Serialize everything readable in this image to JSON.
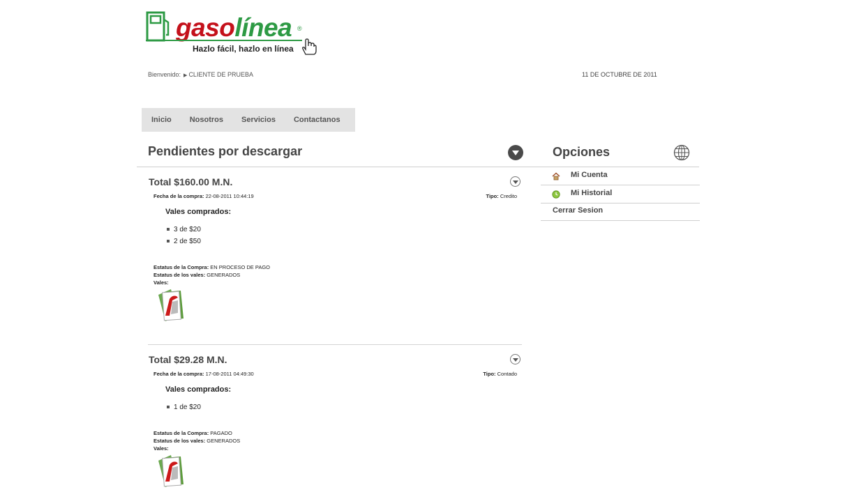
{
  "brand": {
    "word_red": "gaso",
    "word_green": "línea",
    "registered": "®",
    "tagline": "Hazlo fácil, hazlo en línea",
    "colors": {
      "red": "#c4111b",
      "green": "#2d9a44"
    }
  },
  "welcome": {
    "label": "Bienvenido:",
    "user": "CLIENTE DE PRUEBA"
  },
  "date": "11 DE OCTUBRE DE 2011",
  "nav": {
    "items": [
      {
        "label": "Inicio"
      },
      {
        "label": "Nosotros"
      },
      {
        "label": "Servicios"
      },
      {
        "label": "Contactanos"
      }
    ]
  },
  "pending": {
    "title": "Pendientes por descargar",
    "orders": [
      {
        "total": "Total $160.00 M.N.",
        "fecha_label": "Fecha de la compra:",
        "fecha": "22-08-2011 10:44:19",
        "tipo_label": "Tipo:",
        "tipo": "Credito",
        "vales_title": "Vales comprados:",
        "vales": [
          "3 de $20",
          "2 de $50"
        ],
        "estatus_compra_label": "Estatus de la Compra:",
        "estatus_compra": "EN PROCESO DE PAGO",
        "estatus_vales_label": "Estatus de los vales:",
        "estatus_vales": "GENERADOS",
        "vales_label": "Vales:"
      },
      {
        "total": "Total $29.28 M.N.",
        "fecha_label": "Fecha de la compra:",
        "fecha": "17-08-2011 04:49:30",
        "tipo_label": "Tipo:",
        "tipo": "Contado",
        "vales_title": "Vales comprados:",
        "vales": [
          "1 de $20"
        ],
        "estatus_compra_label": "Estatus de la Compra:",
        "estatus_compra": "PAGADO",
        "estatus_vales_label": "Estatus de los vales:",
        "estatus_vales": "GENERADOS",
        "vales_label": "Vales:"
      }
    ]
  },
  "options": {
    "title": "Opciones",
    "items": [
      {
        "label": "Mi Cuenta",
        "icon": "home-icon"
      },
      {
        "label": "Mi Historial",
        "icon": "history-icon"
      },
      {
        "label": "Cerrar Sesion",
        "icon": ""
      }
    ]
  }
}
